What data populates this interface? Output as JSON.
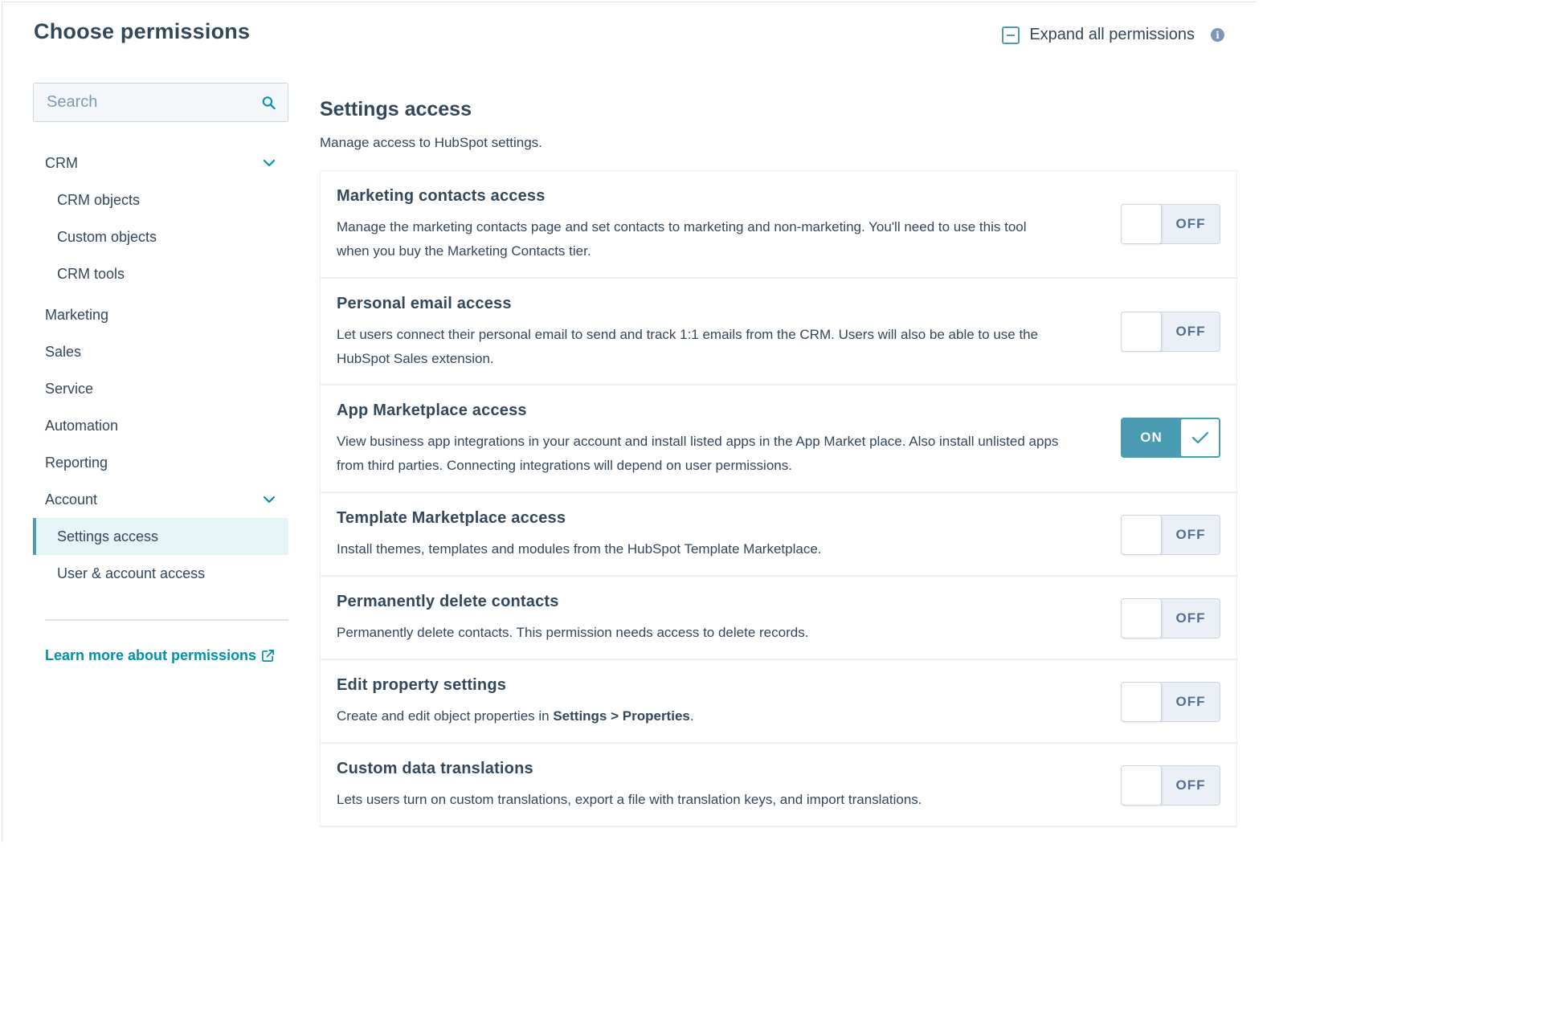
{
  "header": {
    "title": "Choose permissions",
    "expand_all_label": "Expand all permissions"
  },
  "sidebar": {
    "search_placeholder": "Search",
    "items": [
      {
        "label": "CRM",
        "level": 0,
        "expanded": true
      },
      {
        "label": "CRM objects",
        "level": 1
      },
      {
        "label": "Custom objects",
        "level": 1
      },
      {
        "label": "CRM tools",
        "level": 1
      },
      {
        "label": "Marketing",
        "level": 0
      },
      {
        "label": "Sales",
        "level": 0
      },
      {
        "label": "Service",
        "level": 0
      },
      {
        "label": "Automation",
        "level": 0
      },
      {
        "label": "Reporting",
        "level": 0
      },
      {
        "label": "Account",
        "level": 0,
        "expanded": true
      },
      {
        "label": "Settings access",
        "level": 1,
        "active": true
      },
      {
        "label": "User & account access",
        "level": 1
      }
    ],
    "learn_more": "Learn more about permissions"
  },
  "main": {
    "title": "Settings access",
    "subtitle": "Manage access to HubSpot settings.",
    "permissions": [
      {
        "title": "Marketing contacts access",
        "desc": "Manage the marketing contacts page and set contacts to marketing and non-marketing. You'll need to use this tool when you buy the Marketing Contacts tier.",
        "state": "OFF"
      },
      {
        "title": "Personal email access",
        "desc": "Let users connect their personal email to send and track 1:1 emails from the CRM. Users will also be able to use the HubSpot Sales extension.",
        "state": "OFF"
      },
      {
        "title": "App Marketplace access",
        "desc": "View business app integrations in your account and install listed apps in the App Market place. Also install unlisted apps from third parties. Connecting integrations will depend on user permissions.",
        "state": "ON"
      },
      {
        "title": "Template Marketplace access",
        "desc": "Install themes, templates and modules from the HubSpot Template Marketplace.",
        "state": "OFF"
      },
      {
        "title": "Permanently delete contacts",
        "desc": "Permanently delete contacts. This permission needs access to delete records.",
        "state": "OFF"
      },
      {
        "title": "Edit property settings",
        "desc_prefix": "Create and edit object properties in ",
        "desc_bold": "Settings > Properties",
        "desc_suffix": ".",
        "state": "OFF"
      },
      {
        "title": "Custom data translations",
        "desc": "Lets users turn on custom translations, export a file with translation keys, and import translations.",
        "state": "OFF"
      }
    ]
  },
  "colors": {
    "accent": "#4a9cb2",
    "link": "#0091ae",
    "text": "#33475b",
    "active_bg": "#e5f5f8"
  }
}
